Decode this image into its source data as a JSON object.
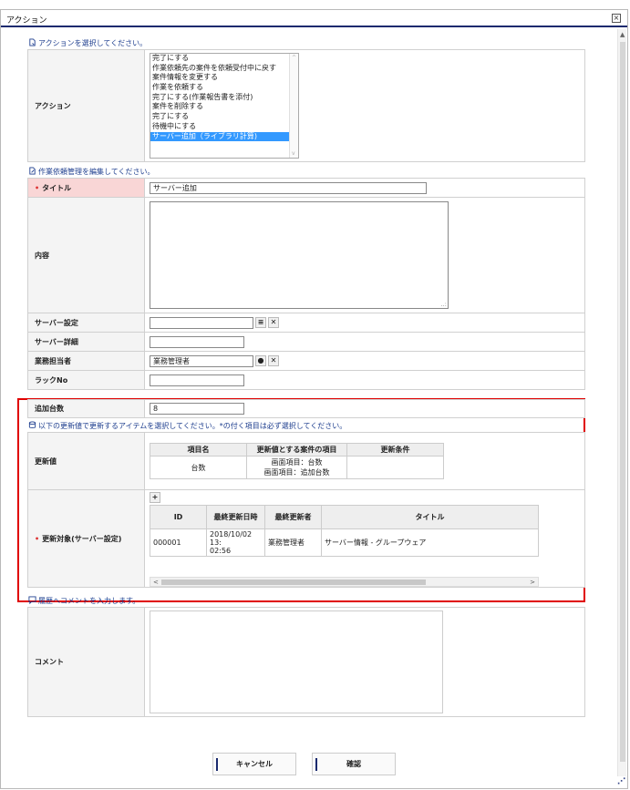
{
  "dialog": {
    "title": "アクション",
    "close_glyph": "×"
  },
  "sections": {
    "action_select": "アクションを選択してください。",
    "edit_request": "作業依頼管理を編集してください。",
    "update_items": "以下の更新値で更新するアイテムを選択してください。*の付く項目は必ず選択してください。",
    "comment": "履歴へコメントを入力します。"
  },
  "action": {
    "label": "アクション",
    "options": [
      "完了にする",
      "作業依頼先の案件を依頼受付中に戻す",
      "案件情報を変更する",
      "作業を依頼する",
      "完了にする(作業報告書を添付)",
      "案件を削除する",
      "完了にする",
      "待機中にする",
      "サーバー追加（ライブラリ計算)"
    ],
    "selected_index": 8
  },
  "fields": {
    "title": {
      "label": "タイトル",
      "value": "サーバー追加"
    },
    "content": {
      "label": "内容",
      "value": ""
    },
    "server_setting": {
      "label": "サーバー設定",
      "value": ""
    },
    "server_detail": {
      "label": "サーバー詳細",
      "value": ""
    },
    "assignee": {
      "label": "業務担当者",
      "value": "業務管理者"
    },
    "rack_no": {
      "label": "ラックNo",
      "value": ""
    },
    "add_count": {
      "label": "追加台数",
      "value": "8"
    }
  },
  "update_values": {
    "label": "更新値",
    "headers": [
      "項目名",
      "更新値とする案件の項目",
      "更新条件"
    ],
    "rows": [
      {
        "name": "台数",
        "source_line1": "画面項目：台数",
        "source_line2": "画面項目：追加台数",
        "condition": ""
      }
    ]
  },
  "update_target": {
    "label": "更新対象(サーバー設定)",
    "add_glyph": "+",
    "headers": [
      "ID",
      "最終更新日時",
      "最終更新者",
      "タイトル"
    ],
    "rows": [
      {
        "id": "000001",
        "updated_line1": "2018/10/02 13:",
        "updated_line2": "02:56",
        "updater": "業務管理者",
        "title": "サーバー情報 - グループウェア"
      }
    ]
  },
  "comment": {
    "label": "コメント",
    "value": ""
  },
  "buttons": {
    "cancel": "キャンセル",
    "confirm": "確認"
  }
}
